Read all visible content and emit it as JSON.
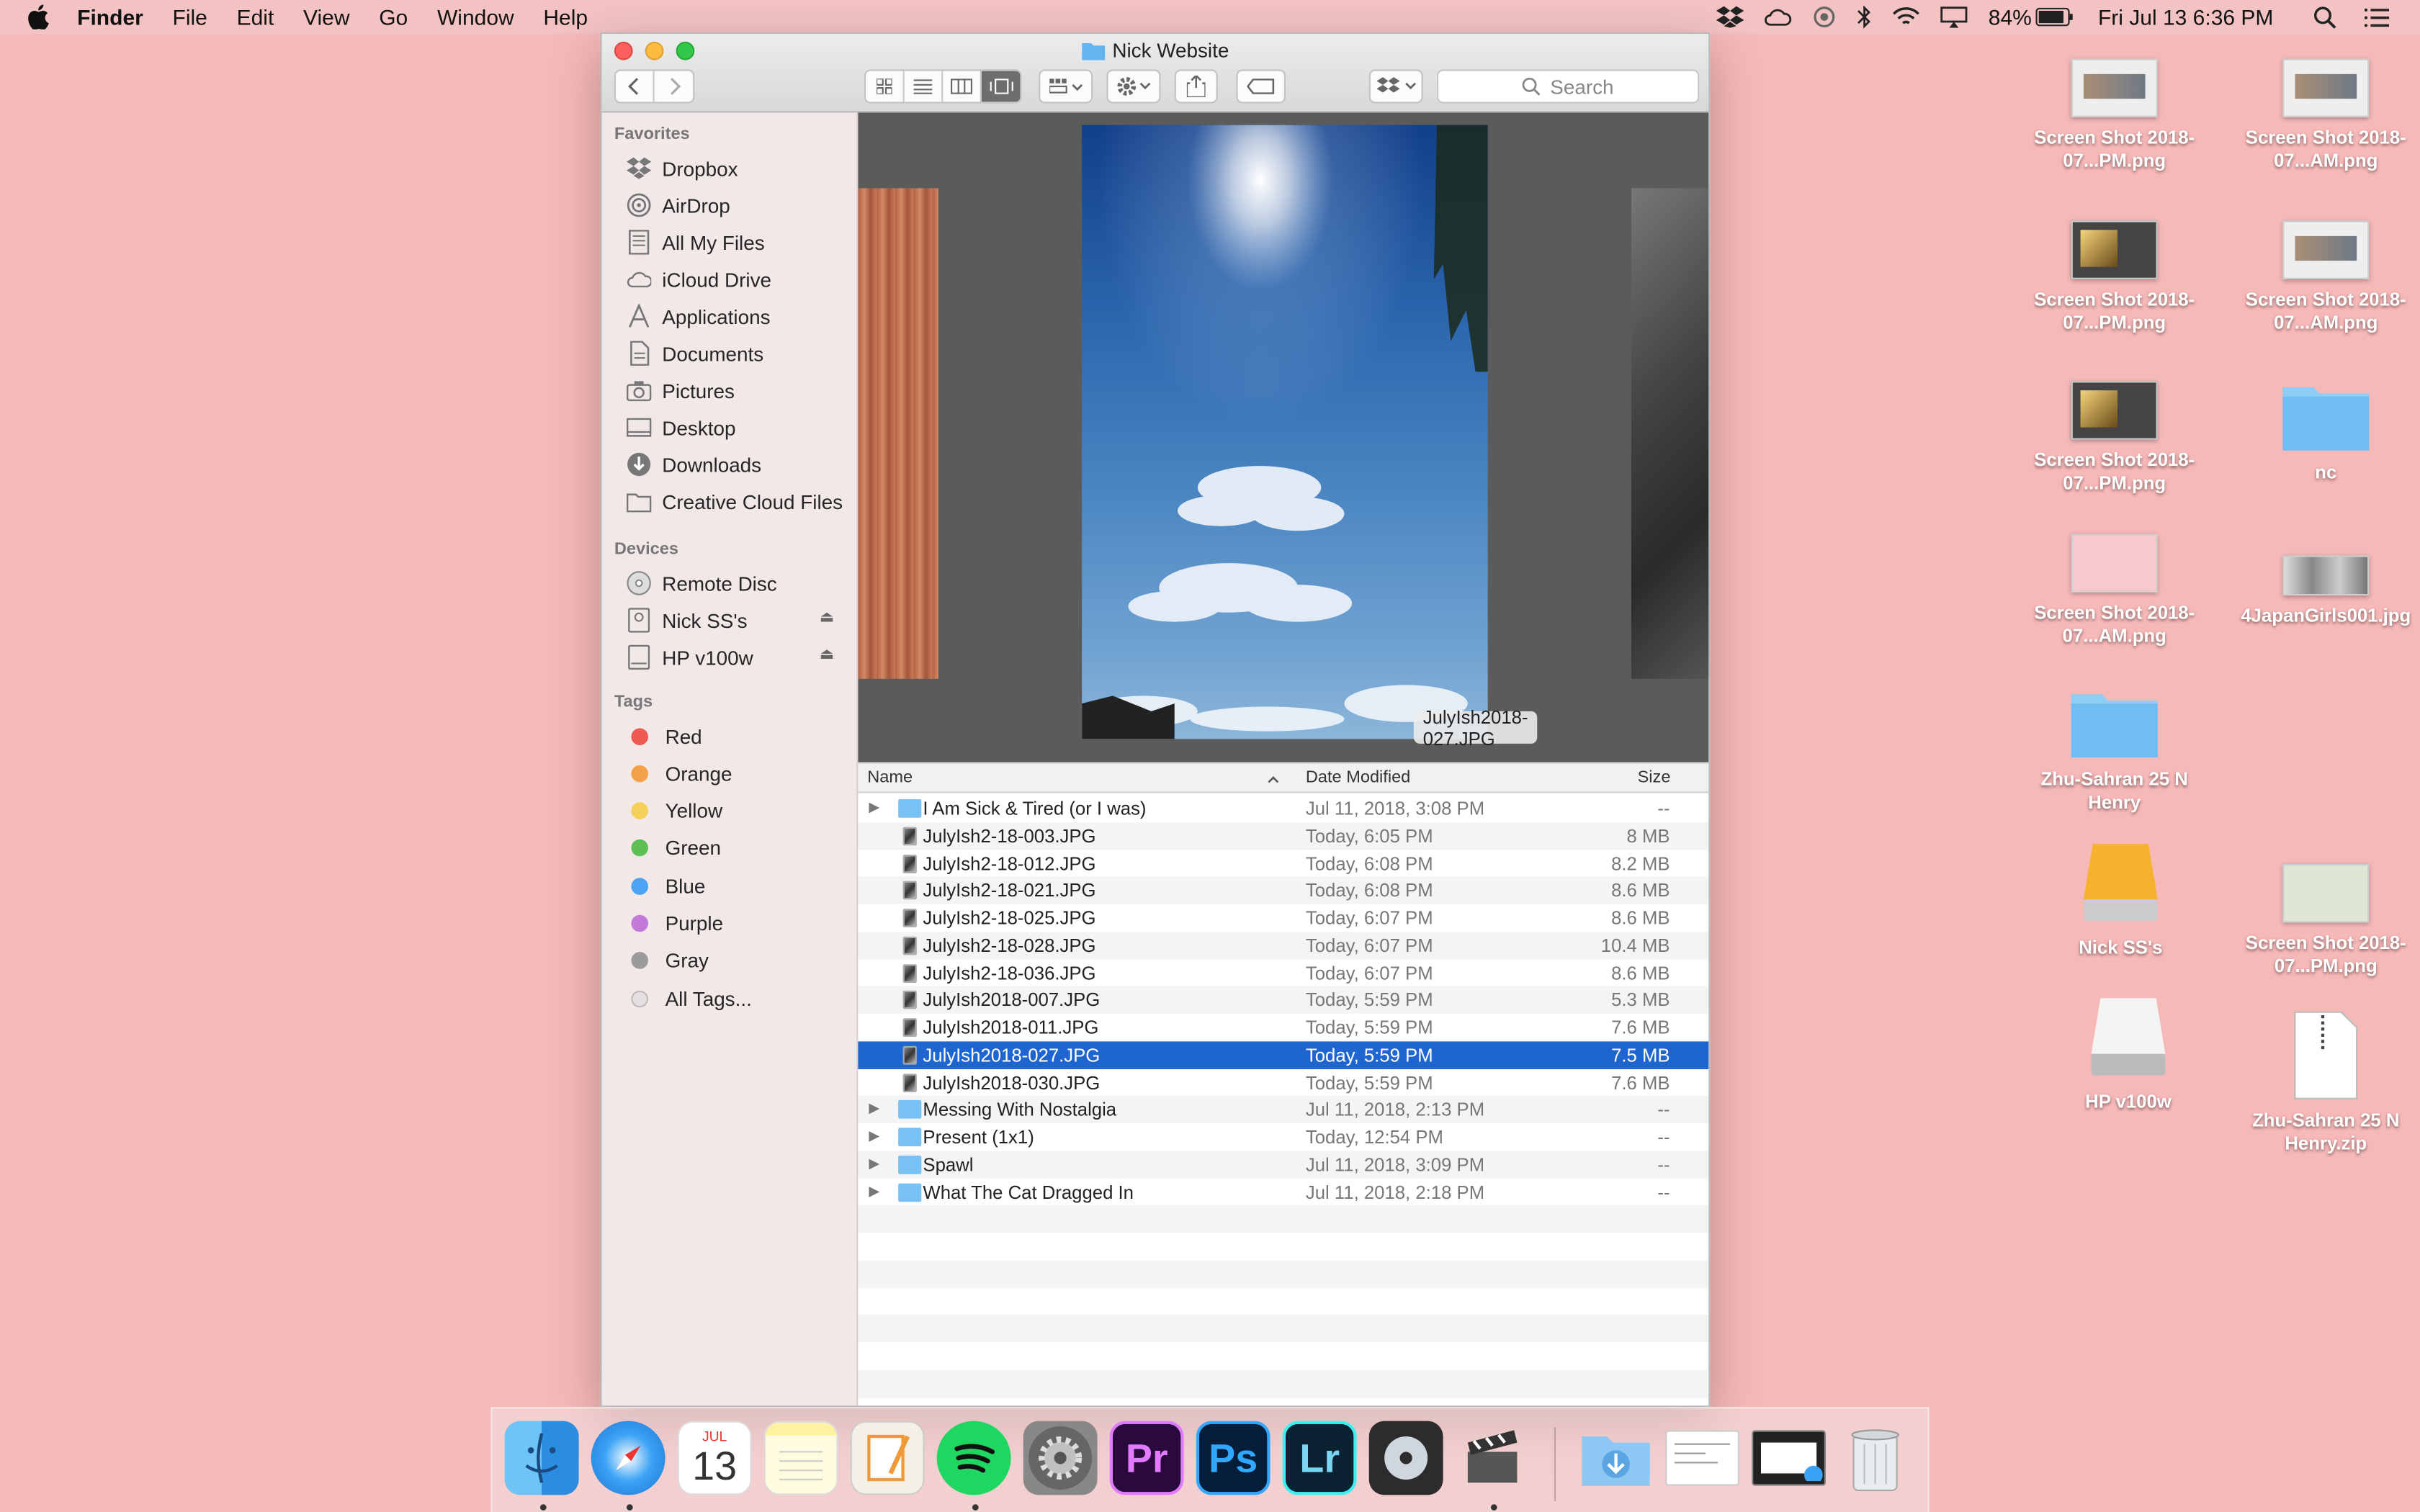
{
  "menubar": {
    "app": "Finder",
    "items": [
      "File",
      "Edit",
      "View",
      "Go",
      "Window",
      "Help"
    ],
    "battery": "84%",
    "clock": "Fri Jul 13  6:36 PM"
  },
  "window": {
    "title": "Nick Website",
    "search_placeholder": "Search"
  },
  "sidebar": {
    "favorites_header": "Favorites",
    "favorites": [
      "Dropbox",
      "AirDrop",
      "All My Files",
      "iCloud Drive",
      "Applications",
      "Documents",
      "Pictures",
      "Desktop",
      "Downloads",
      "Creative Cloud Files"
    ],
    "devices_header": "Devices",
    "devices": [
      "Remote Disc",
      "Nick SS's",
      "HP v100w"
    ],
    "tags_header": "Tags",
    "tags": [
      {
        "label": "Red",
        "color": "#ec5a51"
      },
      {
        "label": "Orange",
        "color": "#f2a04a"
      },
      {
        "label": "Yellow",
        "color": "#f5d15a"
      },
      {
        "label": "Green",
        "color": "#5cc054"
      },
      {
        "label": "Blue",
        "color": "#4da3f2"
      },
      {
        "label": "Purple",
        "color": "#c47ad8"
      },
      {
        "label": "Gray",
        "color": "#9b9b9b"
      },
      {
        "label": "All Tags...",
        "color": "#e6e0e0"
      }
    ]
  },
  "coverflow": {
    "caption": "JulyIsh2018-027.JPG"
  },
  "list": {
    "col_name": "Name",
    "col_date": "Date Modified",
    "col_size": "Size",
    "rows": [
      {
        "name": "I Am Sick & Tired (or I was)",
        "date": "Jul 11, 2018, 3:08 PM",
        "size": "--",
        "folder": true
      },
      {
        "name": "JulyIsh2-18-003.JPG",
        "date": "Today, 6:05 PM",
        "size": "8 MB",
        "folder": false
      },
      {
        "name": "JulyIsh2-18-012.JPG",
        "date": "Today, 6:08 PM",
        "size": "8.2 MB",
        "folder": false
      },
      {
        "name": "JulyIsh2-18-021.JPG",
        "date": "Today, 6:08 PM",
        "size": "8.6 MB",
        "folder": false
      },
      {
        "name": "JulyIsh2-18-025.JPG",
        "date": "Today, 6:07 PM",
        "size": "8.6 MB",
        "folder": false
      },
      {
        "name": "JulyIsh2-18-028.JPG",
        "date": "Today, 6:07 PM",
        "size": "10.4 MB",
        "folder": false
      },
      {
        "name": "JulyIsh2-18-036.JPG",
        "date": "Today, 6:07 PM",
        "size": "8.6 MB",
        "folder": false
      },
      {
        "name": "JulyIsh2018-007.JPG",
        "date": "Today, 5:59 PM",
        "size": "5.3 MB",
        "folder": false
      },
      {
        "name": "JulyIsh2018-011.JPG",
        "date": "Today, 5:59 PM",
        "size": "7.6 MB",
        "folder": false
      },
      {
        "name": "JulyIsh2018-027.JPG",
        "date": "Today, 5:59 PM",
        "size": "7.5 MB",
        "folder": false,
        "selected": true
      },
      {
        "name": "JulyIsh2018-030.JPG",
        "date": "Today, 5:59 PM",
        "size": "7.6 MB",
        "folder": false
      },
      {
        "name": "Messing With Nostalgia",
        "date": "Jul 11, 2018, 2:13 PM",
        "size": "--",
        "folder": true
      },
      {
        "name": "Present (1x1)",
        "date": "Today, 12:54 PM",
        "size": "--",
        "folder": true
      },
      {
        "name": "Spawl",
        "date": "Jul 11, 2018, 3:09 PM",
        "size": "--",
        "folder": true
      },
      {
        "name": "What The Cat Dragged In",
        "date": "Jul 11, 2018, 2:18 PM",
        "size": "--",
        "folder": true
      }
    ]
  },
  "desktop": [
    {
      "label": "Screen Shot 2018-07...PM.png",
      "kind": "shot"
    },
    {
      "label": "Screen Shot 2018-07...AM.png",
      "kind": "shot"
    },
    {
      "label": "Screen Shot 2018-07...PM.png",
      "kind": "shot-dark"
    },
    {
      "label": "Screen Shot 2018-07...AM.png",
      "kind": "shot"
    },
    {
      "label": "Screen Shot 2018-07...PM.png",
      "kind": "shot-dark"
    },
    {
      "label": "nc",
      "kind": "folder"
    },
    {
      "label": "Screen Shot 2018-07...AM.png",
      "kind": "shot-pink"
    },
    {
      "label": "4JapanGirls001.jpg",
      "kind": "photo"
    },
    {
      "label": "Zhu-Sahran 25 N Henry",
      "kind": "folder"
    },
    {
      "label": "Nick SS's",
      "kind": "drive-yellow"
    },
    {
      "label": "Screen Shot 2018-07...PM.png",
      "kind": "shot-green"
    },
    {
      "label": "HP v100w",
      "kind": "drive-white"
    },
    {
      "label": "Zhu-Sahran 25 N Henry.zip",
      "kind": "zip"
    }
  ],
  "dock": {
    "calendar_month": "JUL",
    "calendar_day": "13",
    "premiere": "Pr",
    "photoshop": "Ps",
    "lightroom": "Lr"
  }
}
